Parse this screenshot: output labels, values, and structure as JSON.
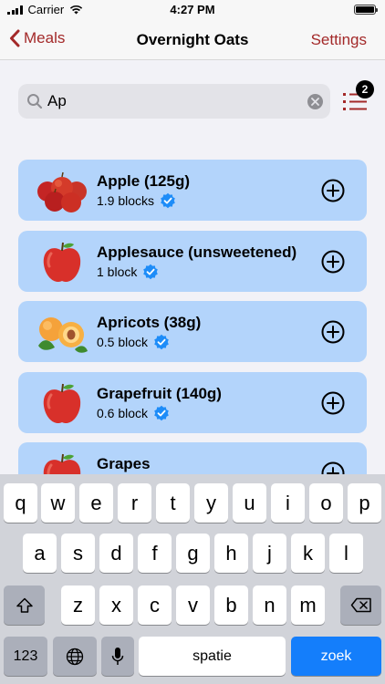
{
  "status_bar": {
    "carrier": "Carrier",
    "time": "4:27 PM"
  },
  "nav": {
    "back_label": "Meals",
    "title": "Overnight Oats",
    "settings_label": "Settings"
  },
  "search": {
    "value": "Ap",
    "badge_count": "2"
  },
  "foods": [
    {
      "name": "Apple (125g)",
      "blocks": "1.9 blocks",
      "image": "apples-image",
      "verified": true
    },
    {
      "name": "Applesauce (unsweetened)",
      "blocks": "1 block",
      "image": "apple-image",
      "verified": true
    },
    {
      "name": "Apricots (38g)",
      "blocks": "0.5 block",
      "image": "apricots-image",
      "verified": true
    },
    {
      "name": "Grapefruit (140g)",
      "blocks": "0.6 block",
      "image": "apple-image",
      "verified": true
    },
    {
      "name": "Grapes",
      "blocks": "",
      "image": "apple-image",
      "verified": false
    }
  ],
  "keyboard": {
    "row1": [
      "q",
      "w",
      "e",
      "r",
      "t",
      "y",
      "u",
      "i",
      "o",
      "p"
    ],
    "row2": [
      "a",
      "s",
      "d",
      "f",
      "g",
      "h",
      "j",
      "k",
      "l"
    ],
    "row3": [
      "z",
      "x",
      "c",
      "v",
      "b",
      "n",
      "m"
    ],
    "numbers_label": "123",
    "space_label": "spatie",
    "enter_label": "zoek"
  },
  "colors": {
    "accent": "#a32929",
    "card": "#b3d4fb",
    "verified": "#1d8cf8",
    "enter": "#147efb"
  },
  "icons": {
    "back": "chevron-left-icon",
    "search": "magnifier-icon",
    "clear": "clear-icon",
    "list": "list-icon",
    "add": "plus-circle-icon",
    "verified": "verified-badge-icon"
  }
}
